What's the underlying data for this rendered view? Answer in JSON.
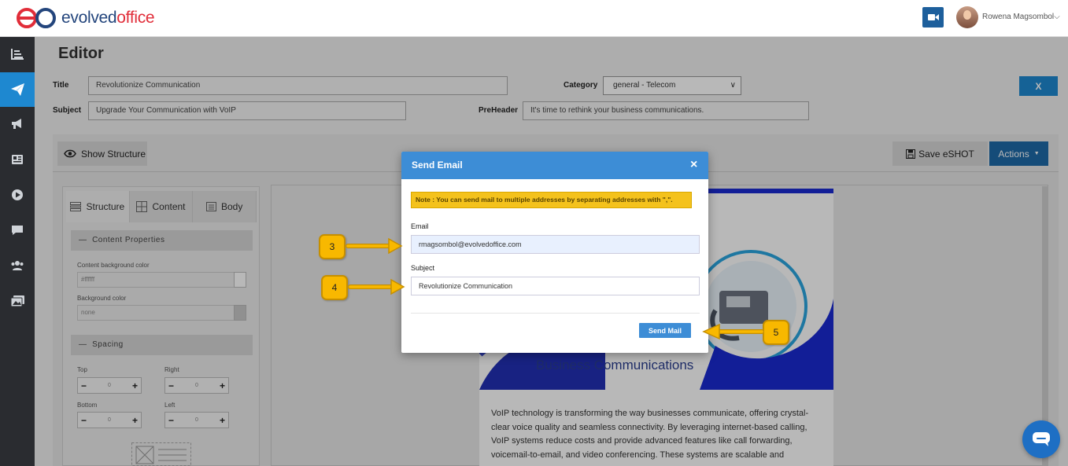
{
  "app": {
    "logo_prefix": "evolved",
    "logo_suffix": "office",
    "user_name": "Rowena Magsombol"
  },
  "editor": {
    "heading": "Editor",
    "title_label": "Title",
    "title_value": "Revolutionize Communication",
    "category_label": "Category",
    "category_value": "general - Telecom",
    "subject_label": "Subject",
    "subject_value": "Upgrade Your Communication with VoIP",
    "preheader_label": "PreHeader",
    "preheader_value": "It's time to rethink your business communications.",
    "close_label": "X"
  },
  "toolbar": {
    "show_structure": "Show Structure",
    "save_label": "Save eSHOT",
    "actions_label": "Actions"
  },
  "left_panel": {
    "tabs": [
      {
        "label": "Structure"
      },
      {
        "label": "Content"
      },
      {
        "label": "Body"
      }
    ],
    "content_properties": "Content Properties",
    "content_bg_label": "Content background color",
    "content_bg_value": "#ffffff",
    "bg_label": "Background color",
    "bg_value": "none",
    "spacing": "Spacing",
    "top_label": "Top",
    "right_label": "Right",
    "bottom_label": "Bottom",
    "left_label": "Left",
    "step_value": "0",
    "minus": "−",
    "plus": "+"
  },
  "preview": {
    "hero_text": "Business Communications",
    "body_lines": [
      "VoIP technology is transforming the way businesses communicate, offering crystal-",
      "clear voice quality and seamless connectivity. By leveraging internet-based calling,",
      "VoIP systems reduce costs and provide advanced features like call forwarding,",
      "voicemail-to-email, and video conferencing. These systems are scalable and"
    ]
  },
  "modal": {
    "title": "Send Email",
    "close": "×",
    "note": "Note : You can send mail to multiple addresses by separating addresses with \",\".",
    "email_label": "Email",
    "email_value": "rmagsombol@evolvedoffice.com",
    "subject_label": "Subject",
    "subject_value": "Revolutionize Communication",
    "send_label": "Send Mail"
  },
  "callouts": {
    "c3": "3",
    "c4": "4",
    "c5": "5"
  },
  "colors": {
    "primary": "#1e88d0",
    "modal_header": "#3d8dd6",
    "note_bg": "#f4c21c",
    "callout": "#f8b800",
    "sidebar": "#2a2c30"
  }
}
